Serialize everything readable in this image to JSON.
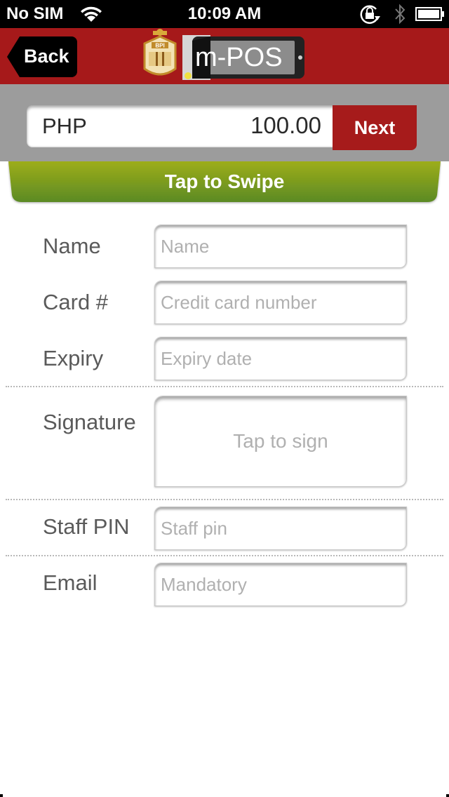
{
  "status_bar": {
    "carrier": "No SIM",
    "time": "10:09 AM",
    "icons": [
      "wifi-icon",
      "rotation-lock-icon",
      "bluetooth-icon",
      "battery-icon"
    ]
  },
  "nav_bar": {
    "back_label": "Back",
    "logo": {
      "bank_crest_text": "BPI",
      "app_name": "m-POS"
    },
    "brand_color": "#a6191a"
  },
  "amount_bar": {
    "currency": "PHP",
    "amount": "100.00",
    "next_label": "Next"
  },
  "swipe": {
    "label": "Tap to Swipe",
    "color_top": "#9dad19",
    "color_bottom": "#5b8a25"
  },
  "form": {
    "name": {
      "label": "Name",
      "placeholder": "Name",
      "value": ""
    },
    "card": {
      "label": "Card #",
      "placeholder": "Credit card number",
      "value": ""
    },
    "expiry": {
      "label": "Expiry",
      "placeholder": "Expiry date",
      "value": ""
    },
    "signature": {
      "label": "Signature",
      "hint": "Tap to sign"
    },
    "staff_pin": {
      "label": "Staff PIN",
      "placeholder": "Staff pin",
      "value": ""
    },
    "email": {
      "label": "Email",
      "placeholder": "Mandatory",
      "value": ""
    }
  }
}
